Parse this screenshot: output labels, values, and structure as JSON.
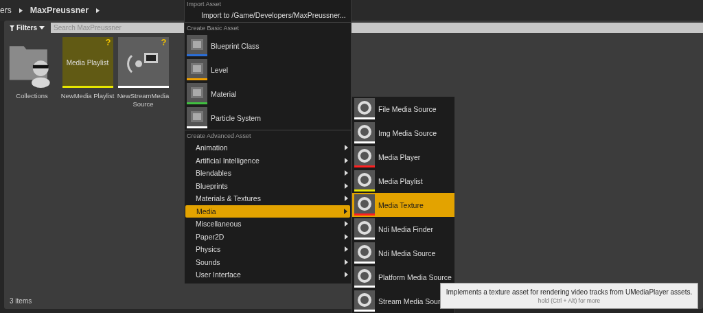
{
  "breadcrumb": [
    {
      "label": "ers",
      "bold": false
    },
    {
      "label": "MaxPreussner",
      "bold": true
    }
  ],
  "filters": {
    "label": "Filters"
  },
  "search": {
    "placeholder": "Search MaxPreussner"
  },
  "assets": [
    {
      "kind": "folder",
      "label": "Collections"
    },
    {
      "kind": "playlist",
      "label": "NewMedia Playlist",
      "thumb_text": "Media Playlist",
      "badge": "?",
      "color": "#e6e600"
    },
    {
      "kind": "stream",
      "label": "NewStreamMedia Source",
      "badge": "?",
      "color": "#ffffff"
    }
  ],
  "status_bar": {
    "count": "3 items"
  },
  "menu": {
    "sections": [
      {
        "kind": "import",
        "header": "Import Asset",
        "items": [
          {
            "label": "Import to /Game/Developers/MaxPreussner..."
          }
        ]
      },
      {
        "kind": "basic",
        "header": "Create Basic Asset",
        "items": [
          {
            "label": "Blueprint Class",
            "color": "#2a6ed8"
          },
          {
            "label": "Level",
            "color": "#f0a000"
          },
          {
            "label": "Material",
            "color": "#40c040"
          },
          {
            "label": "Particle System",
            "color": "#ffffff"
          }
        ]
      },
      {
        "kind": "advanced",
        "header": "Create Advanced Asset",
        "items": [
          {
            "label": "Animation",
            "selected": false
          },
          {
            "label": "Artificial Intelligence",
            "selected": false
          },
          {
            "label": "Blendables",
            "selected": false
          },
          {
            "label": "Blueprints",
            "selected": false
          },
          {
            "label": "Materials & Textures",
            "selected": false
          },
          {
            "label": "Media",
            "selected": true
          },
          {
            "label": "Miscellaneous",
            "selected": false
          },
          {
            "label": "Paper2D",
            "selected": false
          },
          {
            "label": "Physics",
            "selected": false
          },
          {
            "label": "Sounds",
            "selected": false
          },
          {
            "label": "User Interface",
            "selected": false
          }
        ]
      }
    ]
  },
  "submenu": {
    "items": [
      {
        "label": "File Media Source",
        "color": "#ffffff",
        "selected": false
      },
      {
        "label": "Img Media Source",
        "color": "#ffffff",
        "selected": false
      },
      {
        "label": "Media Player",
        "color": "#ff2020",
        "selected": false
      },
      {
        "label": "Media Playlist",
        "color": "#e6e600",
        "selected": false
      },
      {
        "label": "Media Texture",
        "color": "#ff2020",
        "selected": true
      },
      {
        "label": "Ndi Media Finder",
        "color": "#ffffff",
        "selected": false
      },
      {
        "label": "Ndi Media Source",
        "color": "#ffffff",
        "selected": false
      },
      {
        "label": "Platform Media Source",
        "color": "#ffffff",
        "selected": false
      },
      {
        "label": "Stream Media Sour",
        "color": "#ffffff",
        "selected": false
      }
    ]
  },
  "tooltip": {
    "text": "Implements a texture asset for rendering video tracks from UMediaPlayer assets.",
    "hint": "hold (Ctrl + Alt) for more"
  }
}
